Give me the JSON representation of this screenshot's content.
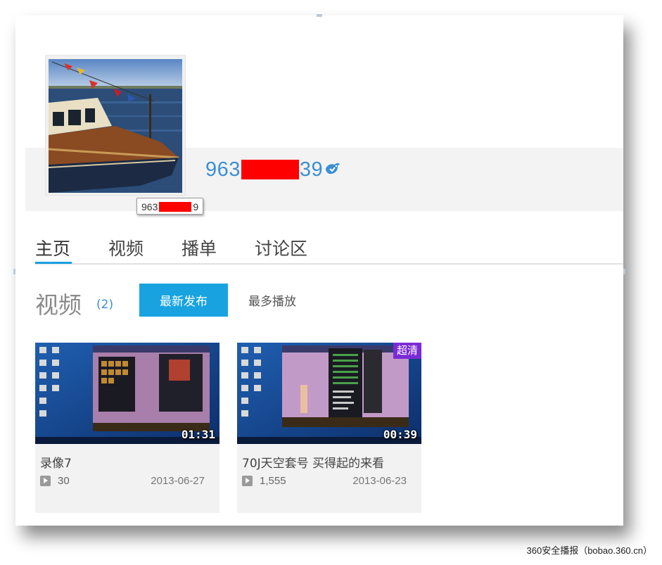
{
  "profile": {
    "username_prefix": "963",
    "username_suffix": "39",
    "tooltip_prefix": "963",
    "tooltip_suffix": "9",
    "verified_icon": "weibo-bird-icon"
  },
  "tabs": [
    {
      "label": "主页",
      "active": true
    },
    {
      "label": "视频",
      "active": false
    },
    {
      "label": "播单",
      "active": false
    },
    {
      "label": "讨论区",
      "active": false
    }
  ],
  "section": {
    "title": "视频",
    "count": "(2)",
    "sort_newest": "最新发布",
    "sort_most_played": "最多播放"
  },
  "videos": [
    {
      "title": "录像7",
      "duration": "01:31",
      "plays": "30",
      "date": "2013-06-27",
      "badge": ""
    },
    {
      "title": "70J天空套号 买得起的来看",
      "duration": "00:39",
      "plays": "1,555",
      "date": "2013-06-23",
      "badge": "超清"
    }
  ],
  "colors": {
    "accent": "#18a3e0",
    "link": "#3a8fd6",
    "hd_badge": "#7b2bd6",
    "redaction": "#ff0000"
  },
  "watermark": "360安全播报（bobao.360.cn）"
}
